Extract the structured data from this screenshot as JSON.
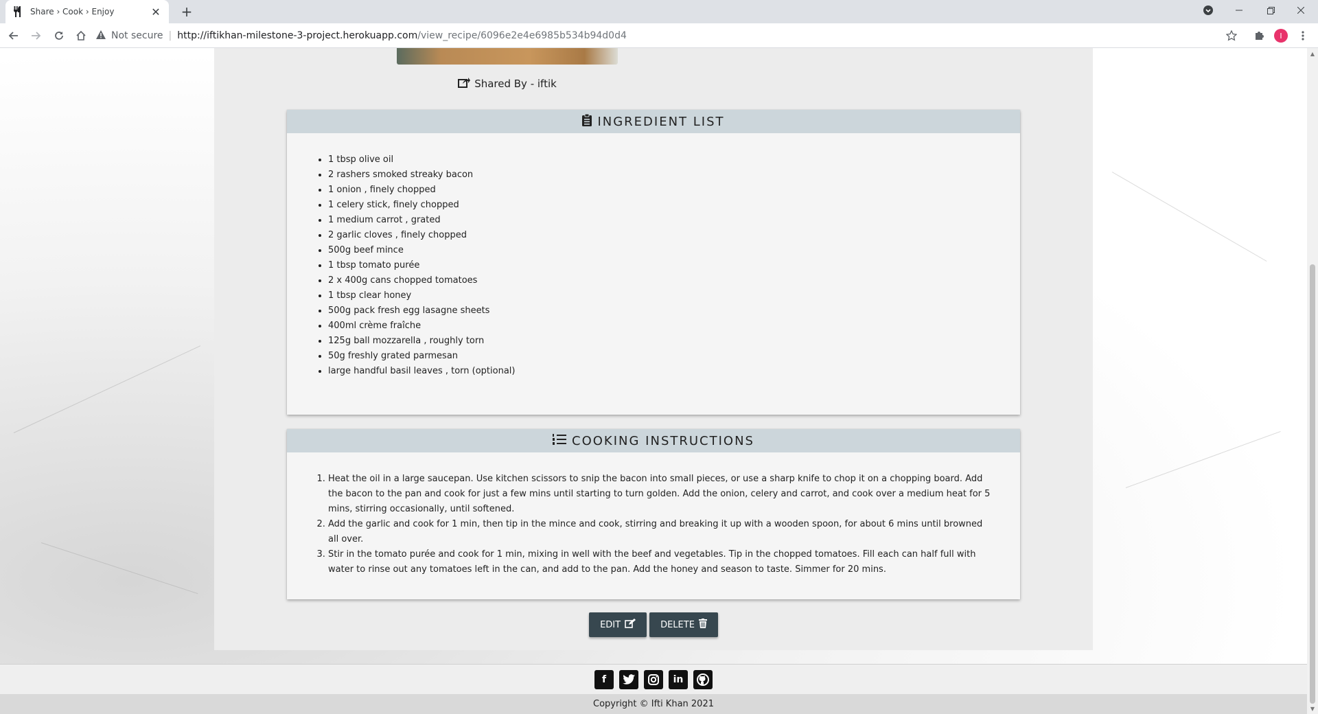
{
  "browser": {
    "tab_title": "Share › Cook › Enjoy",
    "tab_close": "✕",
    "new_tab": "+",
    "not_secure": "Not secure",
    "url_host": "http://iftikhan-milestone-3-project.herokuapp.com",
    "url_path": "/view_recipe/6096e2e4e6985b534b94d0d4",
    "profile_initial": "I"
  },
  "recipe": {
    "shared_by": "Shared By - iftik",
    "ingredients_title": "INGREDIENT LIST",
    "ingredients": [
      "1 tbsp olive oil",
      "2 rashers smoked streaky bacon",
      "1 onion , finely chopped",
      "1 celery stick, finely chopped",
      "1 medium carrot , grated",
      "2 garlic cloves , finely chopped",
      "500g beef mince",
      "1 tbsp tomato purée",
      "2 x 400g cans chopped tomatoes",
      "1 tbsp clear honey",
      "500g pack fresh egg lasagne sheets",
      "400ml crème fraîche",
      "125g ball mozzarella , roughly torn",
      "50g freshly grated parmesan",
      "large handful basil leaves , torn (optional)"
    ],
    "instructions_title": "COOKING INSTRUCTIONS",
    "instructions": [
      "Heat the oil in a large saucepan. Use kitchen scissors to snip the bacon into small pieces, or use a sharp knife to chop it on a chopping board. Add the bacon to the pan and cook for just a few mins until starting to turn golden. Add the onion, celery and carrot, and cook over a medium heat for 5 mins, stirring occasionally, until softened.",
      "Add the garlic and cook for 1 min, then tip in the mince and cook, stirring and breaking it up with a wooden spoon, for about 6 mins until browned all over.",
      "Stir in the tomato purée and cook for 1 min, mixing in well with the beef and vegetables. Tip in the chopped tomatoes. Fill each can half full with water to rinse out any tomatoes left in the can, and add to the pan. Add the honey and season to taste. Simmer for 20 mins."
    ],
    "edit_label": "EDIT",
    "delete_label": "DELETE"
  },
  "footer": {
    "social_icons": [
      "facebook-icon",
      "twitter-icon",
      "instagram-icon",
      "linkedin-icon",
      "github-icon"
    ],
    "copyright": "Copyright © Ifti Khan 2021"
  }
}
